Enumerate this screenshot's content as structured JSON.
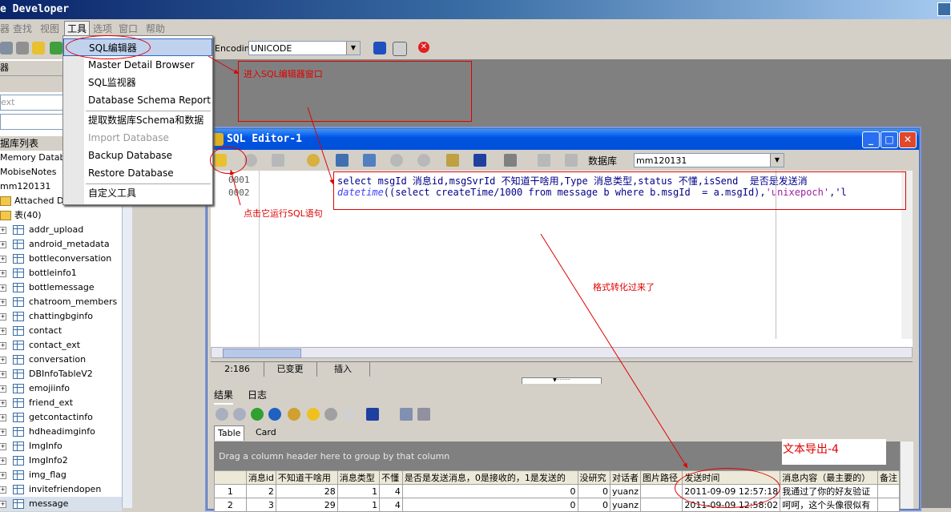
{
  "app": {
    "title": "e Developer"
  },
  "menubar": {
    "items": [
      "器",
      "查找",
      "视图",
      "工具",
      "选项",
      "窗口",
      "帮助"
    ],
    "active": "工具"
  },
  "toolbar": {
    "encoding_label": "Encoding:",
    "encoding_value": "UNICODE"
  },
  "tools_menu": {
    "items": [
      {
        "label": "SQL编辑器",
        "highlighted": true,
        "disabled": false
      },
      {
        "label": "Master Detail Browser",
        "disabled": false
      },
      {
        "label": "SQL监视器",
        "disabled": false
      },
      {
        "label": "Database Schema Report",
        "disabled": false
      },
      {
        "label": "提取数据库Schema和数据",
        "disabled": false
      },
      {
        "label": "Import Database",
        "disabled": true
      },
      {
        "label": "Backup Database",
        "disabled": false
      },
      {
        "label": "Restore Database",
        "disabled": false
      },
      {
        "label": "自定义工具",
        "disabled": false
      }
    ]
  },
  "left_panel": {
    "header1": "器",
    "search_placeholder": "ext",
    "section_title": "据库列表",
    "tree_top": [
      "Memory Databas",
      "MobiseNotes",
      "mm120131"
    ],
    "attached": "Attached Databases(0)",
    "tables_folder": "表(40)",
    "tables": [
      "addr_upload",
      "android_metadata",
      "bottleconversation",
      "bottleinfo1",
      "bottlemessage",
      "chatroom_members",
      "chattingbginfo",
      "contact",
      "contact_ext",
      "conversation",
      "DBInfoTableV2",
      "emojiinfo",
      "friend_ext",
      "getcontactinfo",
      "hdheadimginfo",
      "ImgInfo",
      "ImgInfo2",
      "img_flag",
      "invitefriendopen",
      "message"
    ]
  },
  "sql_editor": {
    "title": "SQL Editor-1",
    "db_label": "数据库",
    "db_value": "mm120131",
    "lines": [
      {
        "no": "0001",
        "text": "select msgId 消息id,msgSvrId 不知道干啥用,Type 消息类型,status 不懂,isSend  是否是发送消"
      },
      {
        "no": "0002",
        "fn": "datetime",
        "text_a": "((select createTime/1000 from message b where b.msgId  = a.msgId),",
        "str": "'unixepoch'",
        "text_b": ",'l"
      }
    ],
    "status": {
      "pos": "2:186",
      "state": "已变更",
      "mode": "插入"
    },
    "result_tabs": [
      "结果",
      "日志"
    ],
    "sub_tabs": [
      "Table",
      "Card"
    ],
    "group_hint": "Drag a column header here to group by that column",
    "columns": [
      "",
      "消息id",
      "不知道干啥用",
      "消息类型",
      "不懂",
      "是否是发送消息，0是接收的，1是发送的",
      "没研究",
      "对话者",
      "图片路径",
      "发送时间",
      "消息内容（最主要的）",
      "备注"
    ],
    "rows": [
      [
        "1",
        "2",
        "28",
        "1",
        "4",
        "0",
        "0",
        "yuanz",
        "",
        "2011-09-09 12:57:18",
        "我通过了你的好友验证",
        ""
      ],
      [
        "2",
        "3",
        "29",
        "1",
        "4",
        "0",
        "0",
        "yuanz",
        "",
        "2011-09-09 12:58:02",
        "呵呵，这个头像很似有",
        ""
      ]
    ]
  },
  "annotations": {
    "enter_editor": "进入SQL编辑器窗口",
    "run_sql": "点击它运行SQL语句",
    "format_converted": "格式转化过来了",
    "export_text": "文本导出-4",
    "color": "#e00000"
  }
}
